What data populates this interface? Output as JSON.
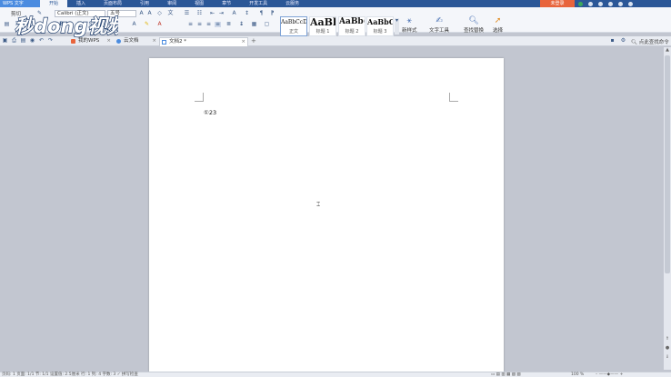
{
  "menubar": {
    "app_name": "WPS 文字",
    "tabs": [
      "开始",
      "插入",
      "页面布局",
      "引用",
      "审阅",
      "视图",
      "章节",
      "开发工具",
      "云服务"
    ],
    "active_tab": "开始",
    "login_label": "未登录"
  },
  "ribbon": {
    "cut_label": "剪切",
    "font_name": "Calibri (正文)",
    "font_size": "五号",
    "styles": [
      {
        "sample": "AaBbCcDd",
        "name": "正文"
      },
      {
        "sample": "AaBb",
        "name": "标题 1"
      },
      {
        "sample": "AaBb(",
        "name": "标题 2"
      },
      {
        "sample": "AaBbC",
        "name": "标题 3"
      }
    ],
    "new_style_label": "新样式",
    "text_tools_label": "文字工具",
    "find_replace_label": "查找替换",
    "select_label": "选择"
  },
  "tabs": {
    "items": [
      {
        "label": "我的WPS"
      },
      {
        "label": "云文档"
      },
      {
        "label": "文档2 *"
      }
    ],
    "search_cmd": "点此查找命令"
  },
  "document": {
    "text": "①23"
  },
  "statusbar": {
    "page_info": "页码: 1  页面: 1/1  节: 1/1  设置值: 2.5厘米  行: 1  列: 4  字数: 3  ✓ 拼写检查",
    "zoom": "100 %"
  },
  "watermark": {
    "text": "秒dong视频"
  },
  "colors": {
    "menubar": "#2b5797",
    "ribbon": "#f4f6fa",
    "workspace": "#c2c6d0",
    "login": "#e8643c"
  }
}
